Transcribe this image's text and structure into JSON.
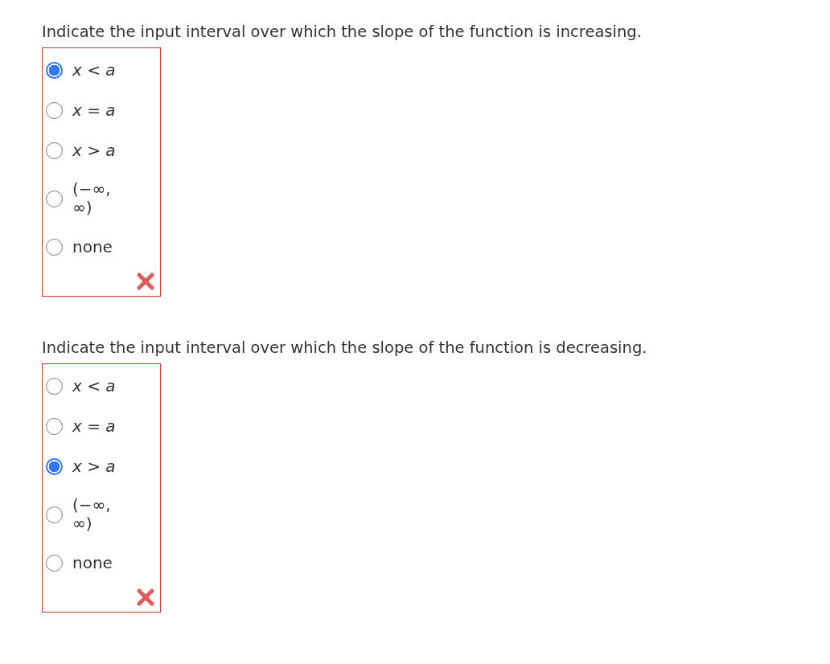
{
  "questions": [
    {
      "prompt": "Indicate the input interval over which the slope of the function is increasing.",
      "correct": false,
      "options": [
        {
          "label": "*x* < *a*",
          "selected": true
        },
        {
          "label": "*x* = *a*",
          "selected": false
        },
        {
          "label": "*x* > *a*",
          "selected": false
        },
        {
          "label": "(−∞, ∞)",
          "selected": false
        },
        {
          "label": "none",
          "selected": false
        }
      ]
    },
    {
      "prompt": "Indicate the input interval over which the slope of the function is decreasing.",
      "correct": false,
      "options": [
        {
          "label": "*x* < *a*",
          "selected": false
        },
        {
          "label": "*x* = *a*",
          "selected": false
        },
        {
          "label": "*x* > *a*",
          "selected": true
        },
        {
          "label": "(−∞, ∞)",
          "selected": false
        },
        {
          "label": "none",
          "selected": false
        }
      ]
    }
  ]
}
